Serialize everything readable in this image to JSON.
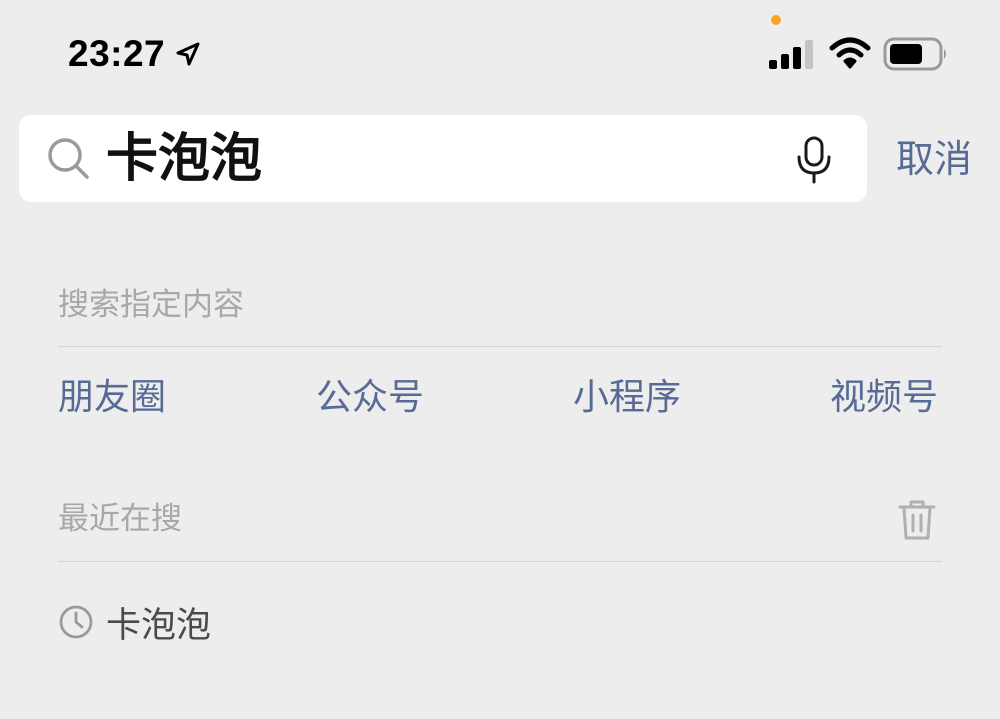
{
  "colors": {
    "background": "#ededed",
    "link_blue": "#576b95",
    "muted_text": "#a8a8a8",
    "recording_dot": "#f5a623"
  },
  "status_bar": {
    "time": "23:27",
    "icons": [
      "location-arrow-icon",
      "recording-dot",
      "signal-icon",
      "wifi-icon",
      "battery-icon"
    ]
  },
  "search": {
    "value": "卡泡泡",
    "icons": [
      "search-icon",
      "microphone-icon"
    ],
    "cancel_label": "取消"
  },
  "search_types": {
    "header": "搜索指定内容",
    "items": [
      {
        "label": "朋友圈"
      },
      {
        "label": "公众号"
      },
      {
        "label": "小程序"
      },
      {
        "label": "视频号"
      }
    ]
  },
  "recent": {
    "header": "最近在搜",
    "clear_icon": "trash-icon",
    "items": [
      {
        "label": "卡泡泡",
        "icon": "clock-icon"
      }
    ]
  }
}
